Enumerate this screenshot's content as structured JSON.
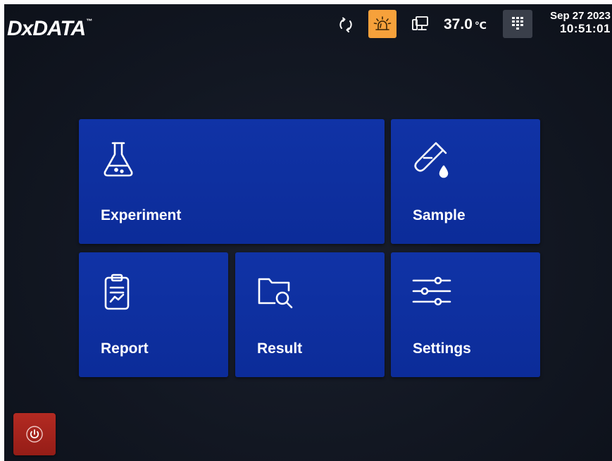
{
  "header": {
    "logo": "DxDATA",
    "logo_tm": "™",
    "temperature": "37.0",
    "temperature_unit": "℃",
    "date": "Sep 27 2023",
    "time": "10:51:01",
    "icons": {
      "sync": "sync-icon",
      "alarm": "alarm-icon",
      "network": "network-icon",
      "keypad": "keypad-icon"
    }
  },
  "tiles": {
    "experiment": {
      "label": "Experiment",
      "icon": "flask-icon"
    },
    "sample": {
      "label": "Sample",
      "icon": "test-tube-icon"
    },
    "report": {
      "label": "Report",
      "icon": "clipboard-chart-icon"
    },
    "result": {
      "label": "Result",
      "icon": "folder-search-icon"
    },
    "settings": {
      "label": "Settings",
      "icon": "sliders-icon"
    }
  },
  "footer": {
    "power": "power-icon"
  },
  "colors": {
    "background": "#131824",
    "tile": "#0e2f9e",
    "alarm": "#f6a13b",
    "power": "#a5241d",
    "text": "#ffffff"
  }
}
